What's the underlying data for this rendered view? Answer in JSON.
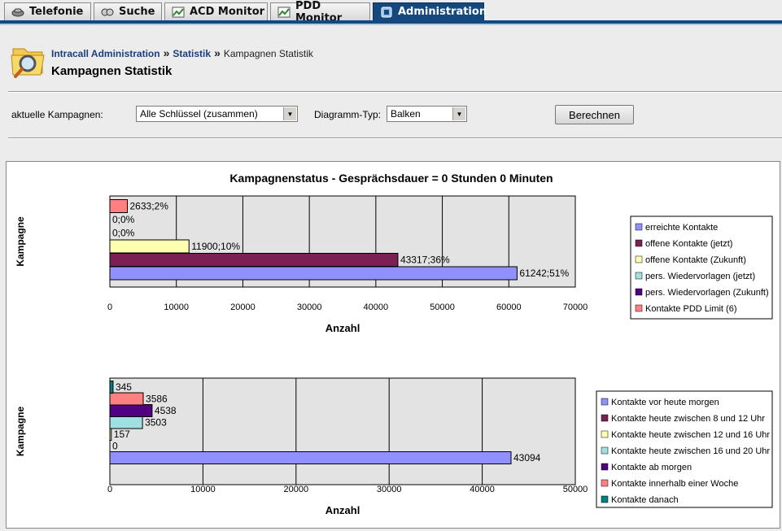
{
  "tabs": [
    {
      "label": "Telefonie",
      "icon": "phone-icon",
      "active": false
    },
    {
      "label": "Suche",
      "icon": "search-icon",
      "active": false
    },
    {
      "label": "ACD Monitor",
      "icon": "chart-icon",
      "active": false
    },
    {
      "label": "PDD Monitor",
      "icon": "chart-icon",
      "active": false
    },
    {
      "label": "Administration",
      "icon": "admin-icon",
      "active": true
    }
  ],
  "breadcrumb": {
    "root": "Intracall Administration",
    "section": "Statistik",
    "current": "Kampagnen Statistik",
    "separator": "»"
  },
  "page_title": "Kampagnen Statistik",
  "controls": {
    "campaign_label": "aktuelle Kampagnen:",
    "campaign_value": "Alle Schlüssel (zusammen)",
    "diagram_type_label": "Diagramm-Typ:",
    "diagram_type_value": "Balken",
    "calculate_button": "Berechnen"
  },
  "chart_data": [
    {
      "type": "bar",
      "orientation": "horizontal",
      "title": "Kampagnenstatus - Gesprächsdauer = 0 Stunden 0 Minuten",
      "xlabel": "Anzahl",
      "ylabel": "Kampagne",
      "xlim": [
        0,
        70000
      ],
      "xticks": [
        "0",
        "10000",
        "20000",
        "30000",
        "40000",
        "50000",
        "60000",
        "70000"
      ],
      "grid": true,
      "legend_position": "right",
      "series": [
        {
          "name": "erreichte Kontakte",
          "value": 61242,
          "label": "61242;51%",
          "color": "#9090ff"
        },
        {
          "name": "offene Kontakte (jetzt)",
          "value": 43317,
          "label": "43317;36%",
          "color": "#7b2052"
        },
        {
          "name": "offene Kontakte (Zukunft)",
          "value": 11900,
          "label": "11900;10%",
          "color": "#ffffb0"
        },
        {
          "name": "pers. Wiedervorlagen (jetzt)",
          "value": 0,
          "label": "0;0%",
          "color": "#a0e0e0"
        },
        {
          "name": "pers. Wiedervorlagen (Zukunft)",
          "value": 0,
          "label": "0;0%",
          "color": "#500080"
        },
        {
          "name": "Kontakte PDD Limit (6)",
          "value": 2633,
          "label": "2633;2%",
          "color": "#ff8080"
        }
      ]
    },
    {
      "type": "bar",
      "orientation": "horizontal",
      "title": "",
      "xlabel": "Anzahl",
      "ylabel": "Kampagne",
      "xlim": [
        0,
        50000
      ],
      "xticks": [
        "0",
        "10000",
        "20000",
        "30000",
        "40000",
        "50000"
      ],
      "grid": true,
      "legend_position": "right",
      "series": [
        {
          "name": "Kontakte vor heute morgen",
          "value": 43094,
          "label": "43094",
          "color": "#9090ff"
        },
        {
          "name": "Kontakte heute zwischen 8 und 12 Uhr",
          "value": 0,
          "label": "0",
          "color": "#7b2052"
        },
        {
          "name": "Kontakte heute zwischen 12 und 16 Uhr",
          "value": 157,
          "label": "157",
          "color": "#ffffb0"
        },
        {
          "name": "Kontakte heute zwischen 16 und 20 Uhr",
          "value": 3503,
          "label": "3503",
          "color": "#a0e0e0"
        },
        {
          "name": "Kontakte ab morgen",
          "value": 4538,
          "label": "4538",
          "color": "#500080"
        },
        {
          "name": "Kontakte innerhalb einer Woche",
          "value": 3586,
          "label": "3586",
          "color": "#ff8080"
        },
        {
          "name": "Kontakte danach",
          "value": 345,
          "label": "345",
          "color": "#008080"
        }
      ]
    }
  ]
}
